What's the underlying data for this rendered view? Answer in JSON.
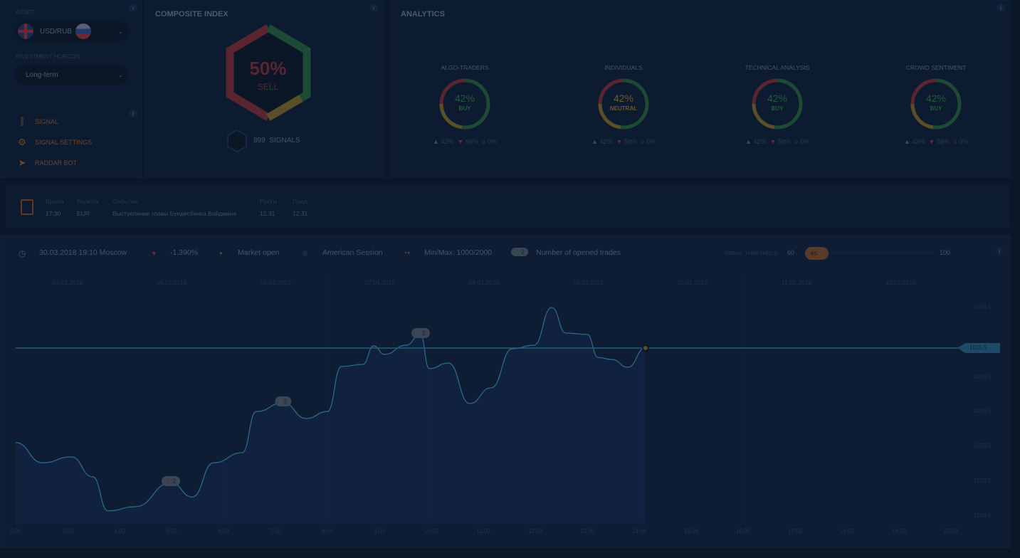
{
  "asset": {
    "label": "ASSET",
    "value": "USD/RUB",
    "horizon_label": "INVESTMENT HORIZON",
    "horizon_value": "Long-term"
  },
  "menu": [
    {
      "icon": "candlestick-icon",
      "label": "SIGNAL"
    },
    {
      "icon": "gear-icon",
      "label": "SIGNAL SETTINGS"
    },
    {
      "icon": "paper-plane-icon",
      "label": "RADDAR BOT"
    }
  ],
  "composite": {
    "title": "COMPOSITE INDEX",
    "percent": "50%",
    "signal": "SELL",
    "signals_count": "899",
    "signals_label": "SIGNALS"
  },
  "analytics": {
    "title": "ANALYTICS",
    "items": [
      {
        "title": "ALGO-TRADERS",
        "percent": "42%",
        "signal": "BUY",
        "up": "42%",
        "down": "58%",
        "neutral": "0%"
      },
      {
        "title": "INDIVIDUALS",
        "percent": "42%",
        "signal": "NEUTRAL",
        "up": "42%",
        "down": "58%",
        "neutral": "0%"
      },
      {
        "title": "TECHNICAL ANALYSIS",
        "percent": "42%",
        "signal": "BUY",
        "up": "42%",
        "down": "58%",
        "neutral": "0%"
      },
      {
        "title": "CROWD SENTIMENT",
        "percent": "42%",
        "signal": "BUY",
        "up": "42%",
        "down": "58%",
        "neutral": "0%"
      }
    ]
  },
  "news": {
    "headers": [
      "Время",
      "Валюта",
      "Событие",
      "Прогн.",
      "Пред."
    ],
    "row": [
      "17:30",
      "EUR",
      "Выступление главы Бундесбанка Вайдмана",
      "12.31",
      "12.31"
    ]
  },
  "toolbar": {
    "datetime": "30.03.2018 19:10 Moscow",
    "change": "-1.390%",
    "market": "Market open",
    "session": "American Session",
    "minmax": "Min/Max: 1000/2000",
    "trades_badge": "2",
    "trades_label": "Number of opened trades",
    "threshold_label": "SIGNAL THRESHOLD",
    "threshold_min": "60",
    "threshold_value": "65",
    "threshold_max": "100"
  },
  "colors": {
    "buy": "#1f5a3e",
    "sell": "#6b2a33",
    "neutral": "#6b5a2a",
    "line": "#2a6a8a",
    "accent": "#6a4530"
  },
  "chart_data": {
    "type": "line",
    "dates": [
      "04.01.2018",
      "05.01.2018",
      "06.01.2018",
      "07.01.2018",
      "08.01.2018",
      "09.01.2018",
      "10.01.2018",
      "11.01.2018",
      "12.01.2018"
    ],
    "x_ticks": [
      "2:00",
      "3:00",
      "4:00",
      "5:00",
      "6:00",
      "7:00",
      "8:00",
      "9:00",
      "10:00",
      "11:00",
      "12:00",
      "13:00",
      "14:00",
      "15:00",
      "16:00",
      "17:00",
      "18:00",
      "19:00",
      "20:00"
    ],
    "y_ticks": [
      "1034.5",
      "1034.5",
      "1033.5",
      "1033.5",
      "1033.5",
      "1033.5",
      "1033.5"
    ],
    "current_price": "1035.5",
    "series": [
      {
        "points": [
          [
            2.0,
            1032.79
          ],
          [
            2.52,
            1032.21
          ],
          [
            3.07,
            1032.38
          ],
          [
            3.48,
            1031.81
          ],
          [
            3.78,
            1030.83
          ],
          [
            4.3,
            1030.95
          ],
          [
            4.99,
            1031.64
          ],
          [
            5.4,
            1031.23
          ],
          [
            5.81,
            1032.21
          ],
          [
            6.36,
            1032.5
          ],
          [
            6.63,
            1033.68
          ],
          [
            7.15,
            1033.93
          ],
          [
            7.59,
            1033.48
          ],
          [
            8.0,
            1033.68
          ],
          [
            8.27,
            1034.97
          ],
          [
            8.68,
            1035.03
          ],
          [
            8.89,
            1035.56
          ],
          [
            9.1,
            1035.32
          ],
          [
            9.51,
            1035.58
          ],
          [
            9.79,
            1035.89
          ],
          [
            9.96,
            1034.91
          ],
          [
            10.33,
            1035.07
          ],
          [
            10.74,
            1033.91
          ],
          [
            11.15,
            1034.36
          ],
          [
            11.56,
            1035.48
          ],
          [
            11.97,
            1035.58
          ],
          [
            12.32,
            1036.66
          ],
          [
            12.59,
            1035.93
          ],
          [
            13.0,
            1035.89
          ],
          [
            13.21,
            1035.23
          ],
          [
            13.48,
            1035.17
          ],
          [
            13.78,
            1034.95
          ],
          [
            14.12,
            1035.5
          ]
        ]
      }
    ],
    "markers": [
      {
        "x": 4.99,
        "y": 1031.64,
        "type": "down",
        "count": "2"
      },
      {
        "x": 7.15,
        "y": 1033.93,
        "type": "neutral",
        "count": "2"
      },
      {
        "x": 9.79,
        "y": 1035.89,
        "type": "up",
        "count": "2"
      }
    ]
  }
}
